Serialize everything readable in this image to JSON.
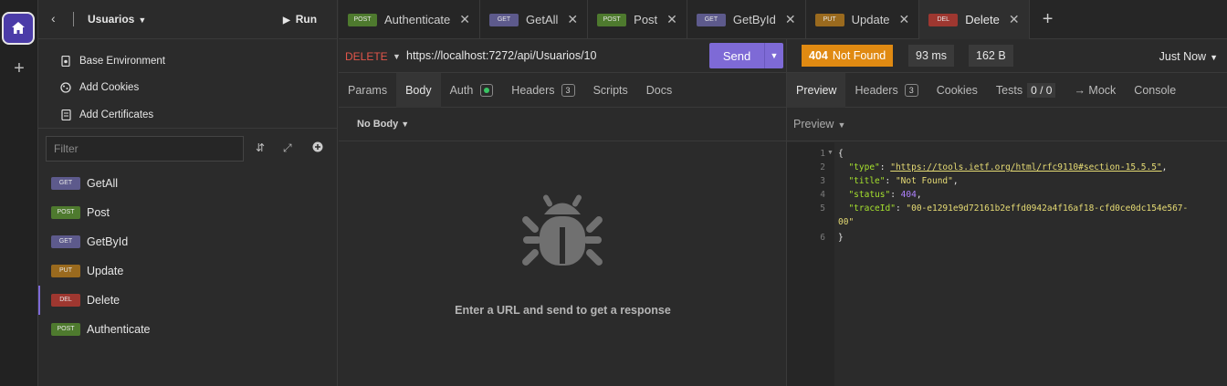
{
  "sidebar": {
    "project": "Usuarios",
    "run_label": "Run",
    "env_items": [
      {
        "label": "Base Environment",
        "icon": "environment-icon"
      },
      {
        "label": "Add Cookies",
        "icon": "cookie-icon"
      },
      {
        "label": "Add Certificates",
        "icon": "certificate-icon"
      }
    ],
    "filter_placeholder": "Filter",
    "requests": [
      {
        "method": "GET",
        "name": "GetAll"
      },
      {
        "method": "POST",
        "name": "Post"
      },
      {
        "method": "GET",
        "name": "GetById"
      },
      {
        "method": "PUT",
        "name": "Update"
      },
      {
        "method": "DEL",
        "name": "Delete",
        "active": true
      },
      {
        "method": "POST",
        "name": "Authenticate"
      }
    ]
  },
  "tabs": [
    {
      "method": "POST",
      "name": "Authenticate"
    },
    {
      "method": "GET",
      "name": "GetAll"
    },
    {
      "method": "POST",
      "name": "Post"
    },
    {
      "method": "GET",
      "name": "GetById"
    },
    {
      "method": "PUT",
      "name": "Update"
    },
    {
      "method": "DEL",
      "name": "Delete",
      "active": true
    }
  ],
  "request": {
    "method": "DELETE",
    "url": "https://localhost:7272/api/Usuarios/10",
    "send_label": "Send",
    "subtabs": {
      "params": "Params",
      "body": "Body",
      "auth": "Auth",
      "headers": "Headers",
      "headers_count": "3",
      "scripts": "Scripts",
      "docs": "Docs"
    },
    "body_type": "No Body",
    "empty_message": "Enter a URL and send to get a response"
  },
  "response": {
    "status_code": "404",
    "status_text": "Not Found",
    "time": "93 ms",
    "size": "162 B",
    "timestamp": "Just Now",
    "tabs": {
      "preview": "Preview",
      "headers": "Headers",
      "headers_count": "3",
      "cookies": "Cookies",
      "tests": "Tests",
      "tests_count": "0 / 0",
      "mock": "→ Mock",
      "console": "Console"
    },
    "preview_mode": "Preview",
    "body_lines": {
      "l1": "{",
      "type_key": "\"type\"",
      "type_val": "\"https://tools.ietf.org/html/rfc9110#section-15.5.5\"",
      "title_key": "\"title\"",
      "title_val": "\"Not Found\"",
      "status_key": "\"status\"",
      "status_val": "404",
      "trace_key": "\"traceId\"",
      "trace_val1": "\"00-e1291e9d72161b2effd0942a4f16af18-cfd0ce0dc154e567-",
      "trace_val2": "00\"",
      "l6": "}"
    },
    "line_numbers": [
      "1",
      "2",
      "3",
      "4",
      "5",
      "6"
    ]
  },
  "colors": {
    "accent": "#7e6ad6",
    "status_404": "#e08a12",
    "delete_method": "#e2554a"
  }
}
